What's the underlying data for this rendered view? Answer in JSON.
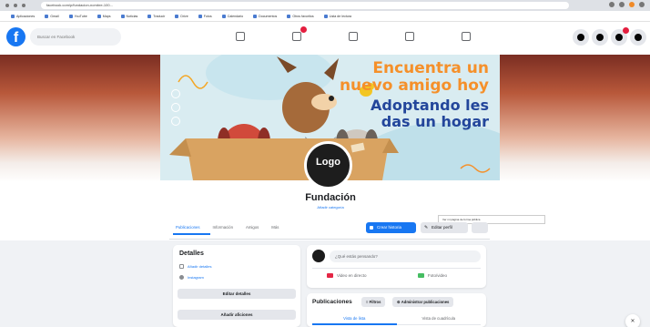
{
  "browser": {
    "url": "facebook.com/p/fundacion-nombre-100...",
    "bookmarks": [
      "Aplicaciones",
      "Gmail",
      "YouTube",
      "Maps",
      "Noticias",
      "Traducir",
      "Drive",
      "Fotos",
      "Calendario",
      "Documentos",
      "Otros favoritos",
      "Lista de lectura"
    ]
  },
  "fb": {
    "logo": "f",
    "search_placeholder": "Buscar en Facebook",
    "nav_icons": [
      "home-icon",
      "video-icon",
      "marketplace-icon",
      "groups-icon",
      "gaming-icon"
    ],
    "right_icons": [
      "menu-icon",
      "messenger-icon",
      "notifications-icon",
      "account-icon"
    ]
  },
  "cover": {
    "headline_1": "Encuentra un",
    "headline_2": "nuevo amigo hoy",
    "headline_3": "Adoptando les",
    "headline_4": "das un hogar",
    "social_icons": [
      "facebook-icon",
      "instagram-icon",
      "whatsapp-icon"
    ],
    "colors": {
      "orange": "#f5902a",
      "navy": "#23469b",
      "sky": "#d9ecf1",
      "box": "#d9a361"
    }
  },
  "profile": {
    "logo_text": "Logo",
    "name": "Fundación",
    "subtitle": "Añadir categoría"
  },
  "tabs": [
    "Publicaciones",
    "Información",
    "Amigos",
    "Más"
  ],
  "actions": {
    "primary": "Crear historia",
    "edit": "Editar perfil",
    "tooltip": "Ver mi página de forma pública"
  },
  "details": {
    "title": "Detalles",
    "info_1": "Añadir detalles",
    "info_2": "Instagram",
    "btn_1": "Editar detalles",
    "btn_2": "Añadir aficiones"
  },
  "composer": {
    "placeholder": "¿Qué estás pensando?",
    "video": "Video en directo",
    "photo": "Foto/video"
  },
  "posts": {
    "title": "Publicaciones",
    "filter": "Filtros",
    "manage": "Administrar publicaciones",
    "view_list": "Vista de lista",
    "view_grid": "Vista de cuadrícula"
  },
  "corner": "✕"
}
